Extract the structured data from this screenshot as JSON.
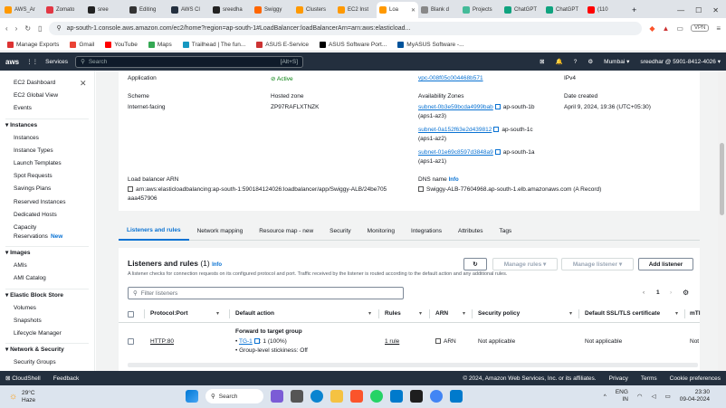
{
  "browser": {
    "tabs": [
      {
        "label": "AWS_Ar",
        "color": "#f90"
      },
      {
        "label": "Zomato",
        "color": "#e23744"
      },
      {
        "label": "sree",
        "color": "#222"
      },
      {
        "label": "Editing",
        "color": "#333"
      },
      {
        "label": "AWS Cl",
        "color": "#232f3e"
      },
      {
        "label": "sreedha",
        "color": "#222"
      },
      {
        "label": "Swiggy",
        "color": "#f60"
      },
      {
        "label": "Clusters",
        "color": "#f90"
      },
      {
        "label": "EC2 Inst",
        "color": "#f90"
      },
      {
        "label": "Loa",
        "color": "#f90",
        "active": true
      },
      {
        "label": "Blank d",
        "color": "#888"
      },
      {
        "label": "Projects",
        "color": "#4b9"
      },
      {
        "label": "ChatGPT",
        "color": "#10a37f"
      },
      {
        "label": "ChatGPT",
        "color": "#10a37f"
      },
      {
        "label": "(110",
        "color": "#f00"
      }
    ],
    "url": "ap-south-1.console.aws.amazon.com/ec2/home?region=ap-south-1#LoadBalancer:loadBalancerArn=arn:aws:elasticload...",
    "vpn": "VPN",
    "bookmarks": [
      {
        "label": "Manage Exports",
        "color": "#d33"
      },
      {
        "label": "Gmail",
        "color": "#ea4335"
      },
      {
        "label": "YouTube",
        "color": "#f00"
      },
      {
        "label": "Maps",
        "color": "#34a853"
      },
      {
        "label": "Trailhead | The fun...",
        "color": "#1798c1"
      },
      {
        "label": "ASUS E-Service",
        "color": "#c33"
      },
      {
        "label": "ASUS Software Port...",
        "color": "#000"
      },
      {
        "label": "MyASUS Software -...",
        "color": "#00539b"
      }
    ]
  },
  "aws": {
    "logo": "aws",
    "services": "Services",
    "search_placeholder": "Search",
    "search_shortcut": "[Alt+S]",
    "region": "Mumbai ▾",
    "account": "sreedhar @ 5901-8412-4026 ▾"
  },
  "sidebar": {
    "items": [
      {
        "label": "EC2 Dashboard",
        "type": "item"
      },
      {
        "label": "EC2 Global View",
        "type": "item"
      },
      {
        "label": "Events",
        "type": "item"
      },
      {
        "label": "Instances",
        "type": "head"
      },
      {
        "label": "Instances",
        "type": "item"
      },
      {
        "label": "Instance Types",
        "type": "item"
      },
      {
        "label": "Launch Templates",
        "type": "item"
      },
      {
        "label": "Spot Requests",
        "type": "item"
      },
      {
        "label": "Savings Plans",
        "type": "item"
      },
      {
        "label": "Reserved Instances",
        "type": "item"
      },
      {
        "label": "Dedicated Hosts",
        "type": "item"
      },
      {
        "label": "Capacity",
        "type": "item"
      },
      {
        "label": "Reservations",
        "type": "item",
        "badge": "New"
      },
      {
        "label": "Images",
        "type": "head"
      },
      {
        "label": "AMIs",
        "type": "item"
      },
      {
        "label": "AMI Catalog",
        "type": "item"
      },
      {
        "label": "Elastic Block Store",
        "type": "head"
      },
      {
        "label": "Volumes",
        "type": "item"
      },
      {
        "label": "Snapshots",
        "type": "item"
      },
      {
        "label": "Lifecycle Manager",
        "type": "item"
      },
      {
        "label": "Network & Security",
        "type": "head"
      },
      {
        "label": "Security Groups",
        "type": "item"
      }
    ]
  },
  "details": {
    "type_value": "Application",
    "status_value": "Active",
    "vpc_link": "vpc-008f05c004468b571",
    "ip_type": "IPv4",
    "scheme_label": "Scheme",
    "scheme_value": "Internet-facing",
    "hosted_zone_label": "Hosted zone",
    "hosted_zone_value": "ZP97RAFLXTNZK",
    "az_label": "Availability Zones",
    "subnets": [
      {
        "id": "subnet-0b3e59bcda4999bab",
        "az": "ap-south-1b",
        "code": "(aps1-az3)"
      },
      {
        "id": "subnet-0a152f63e2d439812",
        "az": "ap-south-1c",
        "code": "(aps1-az2)"
      },
      {
        "id": "subnet-01e69c8597d3848a9",
        "az": "ap-south-1a",
        "code": "(aps1-az1)"
      }
    ],
    "date_label": "Date created",
    "date_value": "April 9, 2024, 19:36 (UTC+05:30)",
    "arn_label": "Load balancer ARN",
    "arn_line1": "arn:aws:elasticloadbalancing:ap-south-1:590184124026:loadbalancer/app/Swiggy-ALB/24be705",
    "arn_line2": "aaa457906",
    "dns_label": "DNS name",
    "dns_info": "Info",
    "dns_value": "Swiggy-ALB-77604968.ap-south-1.elb.amazonaws.com (A Record)"
  },
  "tabs": [
    {
      "label": "Listeners and rules",
      "active": true
    },
    {
      "label": "Network mapping"
    },
    {
      "label": "Resource map - new"
    },
    {
      "label": "Security"
    },
    {
      "label": "Monitoring"
    },
    {
      "label": "Integrations"
    },
    {
      "label": "Attributes"
    },
    {
      "label": "Tags"
    }
  ],
  "listeners": {
    "title": "Listeners and rules",
    "count": "(1)",
    "info": "Info",
    "description": "A listener checks for connection requests on its configured protocol and port. Traffic received by the listener is routed according to the default action and any additional rules.",
    "refresh_icon": "refresh-icon",
    "manage_rules": "Manage rules ▾",
    "manage_listener": "Manage listener ▾",
    "add_listener": "Add listener",
    "filter_placeholder": "Filter listeners",
    "page": "1",
    "columns": [
      "Protocol:Port",
      "Default action",
      "Rules",
      "ARN",
      "Security policy",
      "Default SSL/TLS certificate",
      "mTl"
    ],
    "row": {
      "protocol_port": "HTTP:80",
      "action_title": "Forward to target group",
      "target_group": "TG-1",
      "weight": ": 1 (100%)",
      "stickiness": "Group-level stickiness: Off",
      "rules": "1 rule",
      "arn": "ARN",
      "security_policy": "Not applicable",
      "ssl_cert": "Not applicable",
      "mtls": "Not"
    }
  },
  "footer": {
    "cloudshell": "CloudShell",
    "feedback": "Feedback",
    "copyright": "© 2024, Amazon Web Services, Inc. or its affiliates.",
    "privacy": "Privacy",
    "terms": "Terms",
    "cookies": "Cookie preferences"
  },
  "taskbar": {
    "temp": "29°C",
    "weather": "Haze",
    "search": "Search",
    "lang1": "ENG",
    "lang2": "IN",
    "time": "23:30",
    "date": "09-04-2024"
  }
}
